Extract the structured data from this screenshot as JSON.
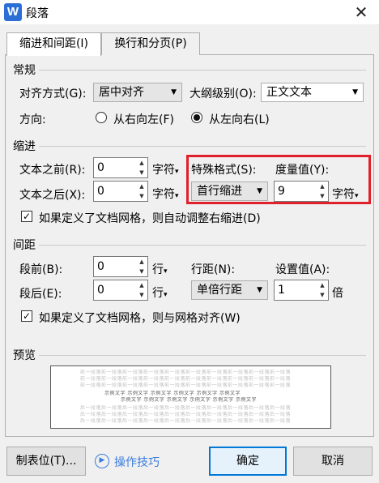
{
  "window": {
    "title": "段落",
    "icon_letter": "W"
  },
  "tabs": [
    {
      "label": "缩进和间距(I)",
      "active": true
    },
    {
      "label": "换行和分页(P)",
      "active": false
    }
  ],
  "general": {
    "section": "常规",
    "align_label": "对齐方式(G):",
    "align_value": "居中对齐",
    "outline_label": "大纲级别(O):",
    "outline_value": "正文文本",
    "direction_label": "方向:",
    "direction_rtl": "从右向左(F)",
    "direction_ltr": "从左向右(L)"
  },
  "indent": {
    "section": "缩进",
    "before_label": "文本之前(R):",
    "before_value": "0",
    "before_unit": "字符",
    "after_label": "文本之后(X):",
    "after_value": "0",
    "after_unit": "字符",
    "special_label": "特殊格式(S):",
    "special_value": "首行缩进",
    "measure_label": "度量值(Y):",
    "measure_value": "9",
    "measure_unit": "字符",
    "auto_adjust": "如果定义了文档网格，则自动调整右缩进(D)"
  },
  "spacing": {
    "section": "间距",
    "before_label": "段前(B):",
    "before_value": "0",
    "before_unit": "行",
    "after_label": "段后(E):",
    "after_value": "0",
    "after_unit": "行",
    "line_label": "行距(N):",
    "line_value": "单倍行距",
    "set_label": "设置值(A):",
    "set_value": "1",
    "set_unit": "倍",
    "snap_grid": "如果定义了文档网格，则与网格对齐(W)"
  },
  "preview": {
    "section": "预览",
    "prev_line": "前一段落前一段落前一段落前一段落前一段落前一段落前一段落前一段落前一段落前一段落",
    "sample_line": "示例文字 示例文字 示例文字 示例文字 示例文字 示例文字",
    "next_line": "后一段落后一段落后一段落后一段落后一段落后一段落后一段落后一段落后一段落后一段落"
  },
  "footer": {
    "tabs_button": "制表位(T)...",
    "tips_link": "操作技巧",
    "ok_button": "确定",
    "cancel_button": "取消"
  },
  "colors": {
    "highlight": "#e0202a",
    "accent": "#0078d7",
    "link": "#3b7ddd"
  }
}
